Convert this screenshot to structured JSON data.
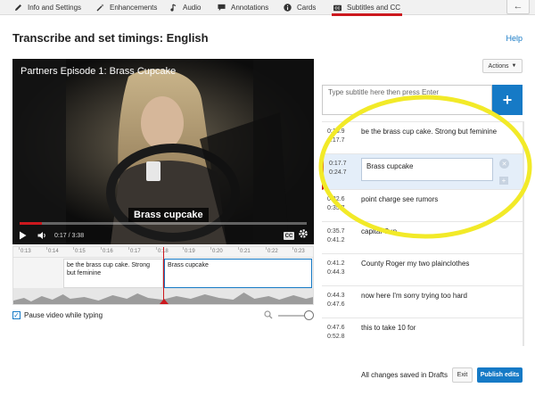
{
  "tabs": [
    {
      "label": "Info and Settings",
      "icon": "pencil-icon"
    },
    {
      "label": "Enhancements",
      "icon": "magic-wand-icon"
    },
    {
      "label": "Audio",
      "icon": "music-note-icon"
    },
    {
      "label": "Annotations",
      "icon": "speech-bubble-icon"
    },
    {
      "label": "Cards",
      "icon": "info-circle-icon"
    },
    {
      "label": "Subtitles and CC",
      "icon": "closed-captions-icon",
      "active": true
    }
  ],
  "page": {
    "title": "Transcribe and set timings: English",
    "help": "Help"
  },
  "video": {
    "title": "Partners Episode 1: Brass Cupcake",
    "caption": "Brass cupcake",
    "time": "0:17 / 3:38",
    "progress": 0.078
  },
  "timeline": {
    "ticks": [
      "0:13",
      "0:14",
      "0:15",
      "0:16",
      "0:17",
      "0:18",
      "0:19",
      "0:20",
      "0:21",
      "0:22",
      "0:23"
    ],
    "cues": [
      {
        "text": "be the brass cup cake. Strong but feminine"
      },
      {
        "text": "Brass cupcake"
      }
    ]
  },
  "options": {
    "pause_label": "Pause video while typing",
    "pause_checked": true
  },
  "actions": {
    "label": "Actions"
  },
  "subtitle_input": {
    "placeholder": "Type subtitle here then press Enter",
    "add": "+"
  },
  "cue_list": [
    {
      "start": "0:15.9",
      "end": "0:17.7",
      "text": "be the brass cup cake. Strong but feminine"
    },
    {
      "start": "0:17.7",
      "end": "0:24.7",
      "text": "Brass cupcake",
      "selected": true
    },
    {
      "start": "0:32.6",
      "end": "0:35.7",
      "text": "point charge see rumors"
    },
    {
      "start": "0:35.7",
      "end": "0:41.2",
      "text": "capital Cup"
    },
    {
      "start": "0:41.2",
      "end": "0:44.3",
      "text": "County Roger my two plainclothes"
    },
    {
      "start": "0:44.3",
      "end": "0:47.6",
      "text": "now here I'm sorry trying too hard"
    },
    {
      "start": "0:47.6",
      "end": "0:52.8",
      "text": "this to take 10 for"
    }
  ],
  "footer": {
    "status": "All changes saved in Drafts",
    "exit": "Exit",
    "publish": "Publish edits"
  },
  "colors": {
    "accent_blue": "#167ac6",
    "accent_red": "#cc181e",
    "highlight_yellow": "#f2ea28"
  }
}
